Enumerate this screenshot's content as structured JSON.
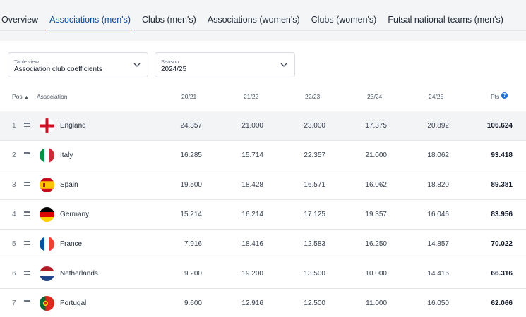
{
  "tabs": [
    {
      "label": "Overview",
      "active": false
    },
    {
      "label": "Associations (men's)",
      "active": true
    },
    {
      "label": "Clubs (men's)",
      "active": false
    },
    {
      "label": "Associations (women's)",
      "active": false
    },
    {
      "label": "Clubs (women's)",
      "active": false
    },
    {
      "label": "Futsal national teams (men's)",
      "active": false
    }
  ],
  "filters": {
    "table_view": {
      "label": "Table view",
      "value": "Association club coefficients"
    },
    "season": {
      "label": "Season",
      "value": "2024/25"
    }
  },
  "table": {
    "headers": {
      "pos": "Pos",
      "association": "Association",
      "seasons": [
        "20/21",
        "21/22",
        "22/23",
        "23/24",
        "24/25"
      ],
      "pts": "Pts"
    },
    "rows": [
      {
        "pos": "1",
        "name": "England",
        "values": [
          "24.357",
          "21.000",
          "23.000",
          "17.375",
          "20.892"
        ],
        "pts": "106.624"
      },
      {
        "pos": "2",
        "name": "Italy",
        "values": [
          "16.285",
          "15.714",
          "22.357",
          "21.000",
          "18.062"
        ],
        "pts": "93.418"
      },
      {
        "pos": "3",
        "name": "Spain",
        "values": [
          "19.500",
          "18.428",
          "16.571",
          "16.062",
          "18.820"
        ],
        "pts": "89.381"
      },
      {
        "pos": "4",
        "name": "Germany",
        "values": [
          "15.214",
          "16.214",
          "17.125",
          "19.357",
          "16.046"
        ],
        "pts": "83.956"
      },
      {
        "pos": "5",
        "name": "France",
        "values": [
          "7.916",
          "18.416",
          "12.583",
          "16.250",
          "14.857"
        ],
        "pts": "70.022"
      },
      {
        "pos": "6",
        "name": "Netherlands",
        "values": [
          "9.200",
          "19.200",
          "13.500",
          "10.000",
          "14.416"
        ],
        "pts": "66.316"
      },
      {
        "pos": "7",
        "name": "Portugal",
        "values": [
          "9.600",
          "12.916",
          "12.500",
          "11.000",
          "16.050"
        ],
        "pts": "62.066"
      }
    ]
  },
  "colors": {
    "accent": "#0a4ba0",
    "info": "#1e6fd9",
    "row_highlight": "#f3f4f6"
  }
}
